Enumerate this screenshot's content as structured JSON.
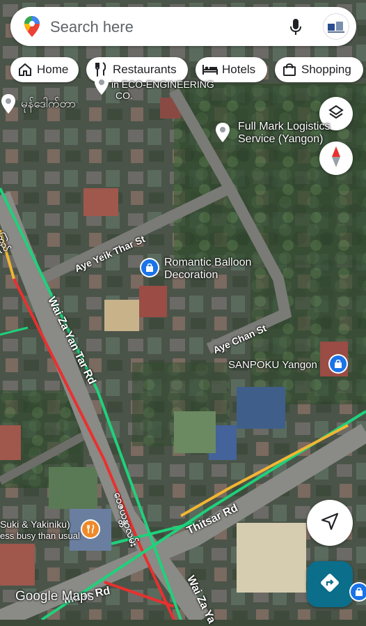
{
  "search": {
    "placeholder": "Search here"
  },
  "chips": [
    {
      "label": "Home",
      "icon": "home-icon"
    },
    {
      "label": "Restaurants",
      "icon": "restaurant-icon"
    },
    {
      "label": "Hotels",
      "icon": "hotel-icon"
    },
    {
      "label": "Shopping",
      "icon": "shopping-bag-icon"
    }
  ],
  "map": {
    "places": [
      {
        "name": "မုန်ဒေါက်တာ"
      },
      {
        "name": "in ECO-ENGINEERING",
        "line2": "CO."
      },
      {
        "name": "Full Mark Logistics",
        "line2": "Service (Yangon)"
      },
      {
        "name": "Romantic Balloon",
        "line2": "Decoration"
      },
      {
        "name": "SANPOKU Yangon"
      },
      {
        "name": "Suki & Yakiniku)",
        "line2": "ess busy than usual"
      }
    ],
    "roads": [
      "Aye Yeik Thar St",
      "Wai Za Yan Tar Rd",
      "Aye Chan St",
      "Thitsar Rd",
      "ဝေဇယန္တာလမ်း",
      "mbae Rd",
      "Wai Za Ya",
      "ကြည်"
    ],
    "logo": "Google Maps",
    "colors": {
      "traffic_green": "#1fd17b",
      "traffic_red": "#e8312f",
      "traffic_yellow": "#f2b632",
      "poi_blue": "#1a73e8",
      "poi_orange": "#ef8a2a",
      "nav_teal": "#0b6e8a"
    }
  }
}
